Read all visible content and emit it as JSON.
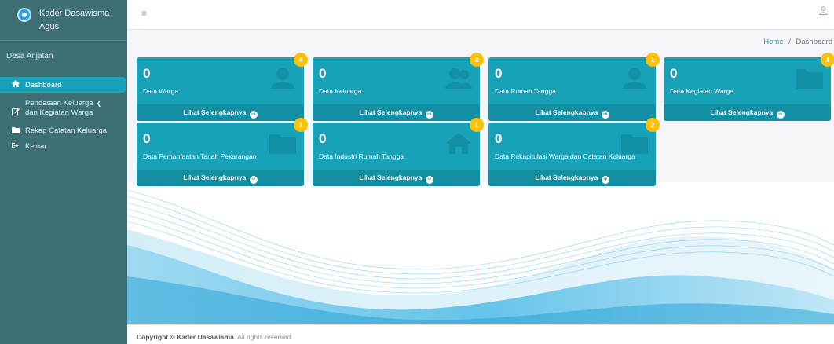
{
  "app": {
    "title": "Kader Dasawisma",
    "user": "Agus",
    "village": "Desa Anjatan"
  },
  "sidebar": {
    "items": [
      {
        "label": "Dashboard",
        "icon": "home-icon",
        "active": true
      },
      {
        "label_line1": "Pendataan Keluarga",
        "label_line2": "dan Kegiatan Warga",
        "icon": "edit-icon"
      },
      {
        "label": "Rekap Catatan Keluarga",
        "icon": "folder-icon"
      },
      {
        "label": "Keluar",
        "icon": "sign-out-icon"
      }
    ]
  },
  "breadcrumb": {
    "home": "Home",
    "separator": "/",
    "current": "Dashboard"
  },
  "cards": [
    {
      "value": "0",
      "label": "Data Warga",
      "badge": "4",
      "link": "Lihat Selengkapnya",
      "icon": "user-icon"
    },
    {
      "value": "0",
      "label": "Data Keluarga",
      "badge": "2",
      "link": "Lihat Selengkapnya",
      "icon": "users-icon"
    },
    {
      "value": "0",
      "label": "Data Rumah Tangga",
      "badge": "1",
      "link": "Lihat Selengkapnya",
      "icon": "user-icon"
    },
    {
      "value": "0",
      "label": "Data Kegiatan Warga",
      "badge": "1",
      "link": "Lihat Selengkapnya",
      "icon": "folder-icon"
    },
    {
      "value": "0",
      "label": "Data Pemanfaatan Tanah Pekarangan",
      "badge": "1",
      "link": "Lihat Selengkapnya",
      "icon": "folder-icon"
    },
    {
      "value": "0",
      "label": "Data Industri Rumah Tangga",
      "badge": "1",
      "link": "Lihat Selengkapnya",
      "icon": "home-icon"
    },
    {
      "value": "0",
      "label": "Data Rekapitulasi Warga dan Catatan Keluarga",
      "badge": "2",
      "link": "Lihat Selengkapnya",
      "icon": "folder-icon"
    }
  ],
  "footer": {
    "prefix": "Copyright ©",
    "brand": "Kader Dasawisma.",
    "suffix": "All rights reserved."
  },
  "colors": {
    "sidebar": "#3d6f75",
    "accent": "#17a2b8",
    "badge": "#ffc107"
  }
}
